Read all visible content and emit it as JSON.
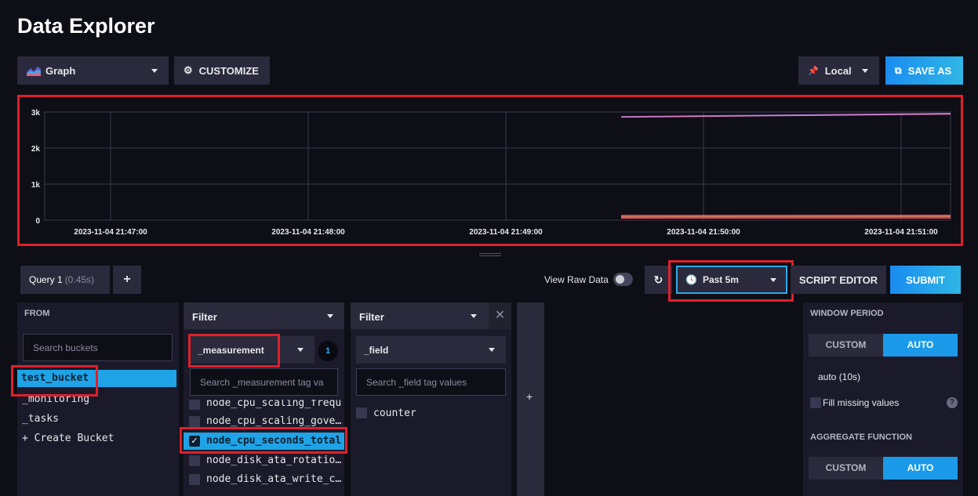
{
  "page": {
    "title": "Data Explorer"
  },
  "toolbar": {
    "graph_type": "Graph",
    "customize": "CUSTOMIZE",
    "timezone": "Local",
    "save_as": "SAVE AS"
  },
  "chart_data": {
    "type": "line",
    "y_ticks": [
      "3k",
      "2k",
      "1k",
      "0"
    ],
    "ylim": [
      0,
      3000
    ],
    "x_ticks": [
      "2023-11-04 21:47:00",
      "2023-11-04 21:48:00",
      "2023-11-04 21:49:00",
      "2023-11-04 21:50:00",
      "2023-11-04 21:51:00"
    ],
    "x_range": [
      "2023-11-04 21:46:40",
      "2023-11-04 21:51:15"
    ],
    "grid": true,
    "series": [
      {
        "x": [
          "2023-11-04 21:49:35",
          "2023-11-04 21:51:15"
        ],
        "values": [
          2870,
          2960
        ],
        "color": "#8e6fd8"
      },
      {
        "x": [
          "2023-11-04 21:49:35",
          "2023-11-04 21:51:15"
        ],
        "values": [
          2860,
          2945
        ],
        "color": "#e07cc4"
      },
      {
        "x": [
          "2023-11-04 21:49:35",
          "2023-11-04 21:51:15"
        ],
        "values": [
          130,
          135
        ],
        "color": "#e85a6a"
      },
      {
        "x": [
          "2023-11-04 21:49:35",
          "2023-11-04 21:51:15"
        ],
        "values": [
          95,
          100
        ],
        "color": "#d97a5a"
      },
      {
        "x": [
          "2023-11-04 21:49:35",
          "2023-11-04 21:51:15"
        ],
        "values": [
          60,
          62
        ],
        "color": "#e85a6a"
      }
    ]
  },
  "query": {
    "tab_label": "Query 1",
    "tab_time": "(0.45s)",
    "add": "+",
    "view_raw": "View Raw Data",
    "time_range": "Past 5m",
    "script_editor": "SCRIPT EDITOR",
    "submit": "SUBMIT"
  },
  "from": {
    "header": "FROM",
    "search_placeholder": "Search buckets",
    "buckets": [
      "test_bucket",
      "_monitoring",
      "_tasks",
      "+ Create Bucket"
    ]
  },
  "filter1": {
    "header": "Filter",
    "key": "_measurement",
    "count": "1",
    "search_placeholder": "Search _measurement tag va",
    "items": [
      "node_cpu_scaling_frequ",
      "node_cpu_scaling_gove…",
      "node_cpu_seconds_total",
      "node_disk_ata_rotatio…",
      "node_disk_ata_write_c…"
    ]
  },
  "filter2": {
    "header": "Filter",
    "key": "_field",
    "search_placeholder": "Search _field tag values",
    "items": [
      "counter"
    ]
  },
  "add_filter": "+",
  "window": {
    "header": "WINDOW PERIOD",
    "custom": "CUSTOM",
    "auto": "AUTO",
    "auto_value": "auto (10s)",
    "fill_missing": "Fill missing values",
    "help": "?"
  },
  "aggregate": {
    "header": "AGGREGATE FUNCTION",
    "custom": "CUSTOM",
    "auto": "AUTO"
  }
}
